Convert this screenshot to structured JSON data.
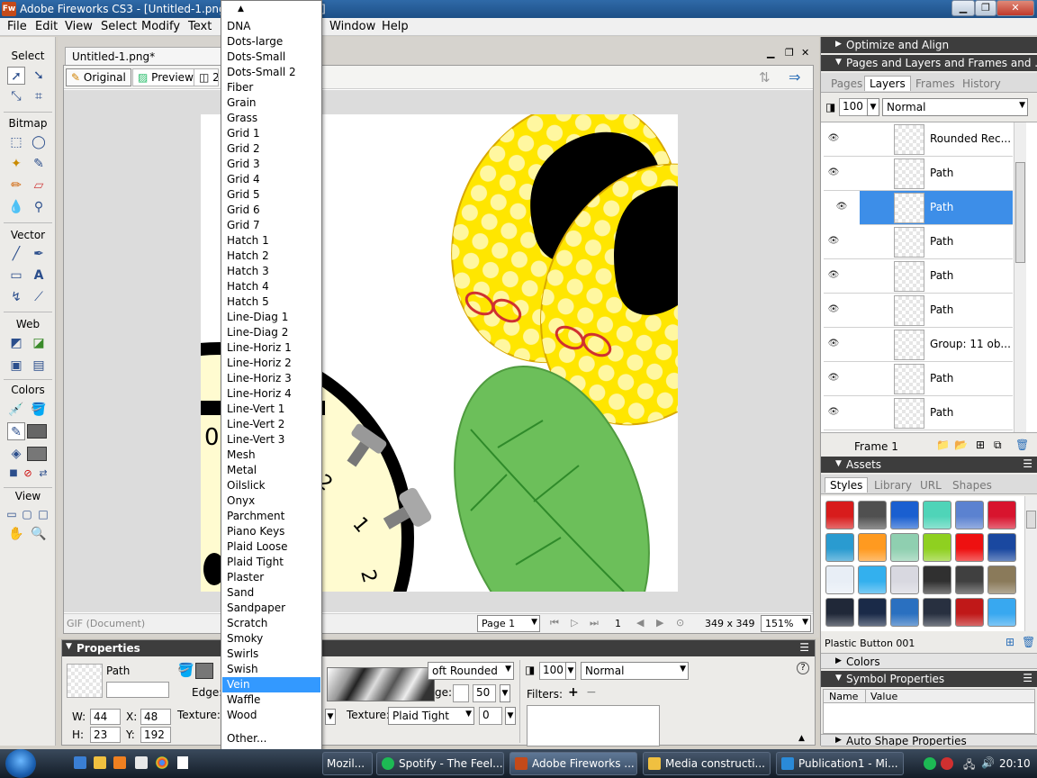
{
  "window": {
    "title": "Adobe Fireworks CS3 - [Untitled-1.png : P",
    "title_tail": "]",
    "logo": "Fw"
  },
  "menubar": [
    "File",
    "Edit",
    "View",
    "Select",
    "Modify",
    "Text",
    "Window",
    "Help"
  ],
  "tools": {
    "sections": [
      "Select",
      "Bitmap",
      "Vector",
      "Web",
      "Colors",
      "View"
    ]
  },
  "document": {
    "tab": "Untitled-1.png*",
    "view_buttons": [
      "Original",
      "Preview",
      "2-"
    ],
    "status_left": "GIF (Document)",
    "page": "Page 1",
    "frame_number": "1",
    "size": "349 x 349",
    "zoom": "151%"
  },
  "canvas_text": {
    "clock_digit_0": "0",
    "clock_digit_2a": "2",
    "clock_digit_1": "1",
    "clock_digit_2b": "2"
  },
  "dropdown": {
    "items": [
      "DNA",
      "Dots-large",
      "Dots-Small",
      "Dots-Small 2",
      "Fiber",
      "Grain",
      "Grass",
      "Grid 1",
      "Grid 2",
      "Grid 3",
      "Grid 4",
      "Grid 5",
      "Grid 6",
      "Grid 7",
      "Hatch 1",
      "Hatch 2",
      "Hatch 3",
      "Hatch 4",
      "Hatch 5",
      "Line-Diag 1",
      "Line-Diag 2",
      "Line-Horiz 1",
      "Line-Horiz 2",
      "Line-Horiz 3",
      "Line-Horiz 4",
      "Line-Vert 1",
      "Line-Vert 2",
      "Line-Vert 3",
      "Mesh",
      "Metal",
      "Oilslick",
      "Onyx",
      "Parchment",
      "Piano Keys",
      "Plaid Loose",
      "Plaid Tight",
      "Plaster",
      "Sand",
      "Sandpaper",
      "Scratch",
      "Smoky",
      "Swirls",
      "Swish",
      "Vein",
      "Waffle",
      "Wood"
    ],
    "selected": "Vein",
    "other": "Other..."
  },
  "properties": {
    "title": "Properties",
    "object_type": "Path",
    "edge_label": "Edge:",
    "texture_label": "Texture:",
    "w_label": "W:",
    "w": "44",
    "h_label": "H:",
    "h": "23",
    "x_label": "X:",
    "x": "48",
    "y_label": "Y:",
    "y": "192",
    "stroke_tip": "oft Rounded",
    "edge_partial": "ge:",
    "edge_value": "50",
    "stroke_texture_label": "Texture:",
    "stroke_texture": "Plaid Tight",
    "stroke_texture_amount": "0",
    "opacity": "100",
    "blend": "Normal",
    "filters_label": "Filters:",
    "filters_add": "+",
    "filters_remove": "−"
  },
  "panels": {
    "optimize": "Optimize and Align",
    "pages_layers": "Pages and Layers and Frames and ...",
    "tabs": [
      "Pages",
      "Layers",
      "Frames",
      "History"
    ],
    "active_tab": "Layers",
    "opacity": "100",
    "blend": "Normal",
    "layers": [
      "Rounded Rec...",
      "Path",
      "Path",
      "Path",
      "Path",
      "Path",
      "Group: 11 ob...",
      "Path",
      "Path"
    ],
    "selected_layer_index": 2,
    "frame_label": "Frame 1",
    "assets": "Assets",
    "assets_tabs": [
      "Styles",
      "Library",
      "URL",
      "Shapes"
    ],
    "assets_active": "Styles",
    "style_name": "Plastic Button 001",
    "colors": "Colors",
    "symbol_properties": "Symbol Properties",
    "sym_cols": [
      "Name",
      "Value"
    ],
    "auto_shape": "Auto Shape Properties"
  },
  "swatch_colors": [
    "#d81c1c",
    "#505050",
    "#1a5fd0",
    "#4fd4b8",
    "#5b82d0",
    "#d8142e",
    "#2a9bd0",
    "#ff9a20",
    "#8fcfb0",
    "#8fd020",
    "#ee1010",
    "#1a48a0",
    "#e8eef6",
    "#33b0ee",
    "#d8d8e0",
    "#303030",
    "#404040",
    "#8a7a5a",
    "#202838",
    "#1a2a48",
    "#2a70c0",
    "#283040",
    "#c01818",
    "#38a8f0"
  ],
  "taskbar": {
    "buttons": [
      " Mozil...",
      "Spotify - The Feel...",
      "Adobe Fireworks ...",
      "Media constructi...",
      "Publication1 - Mi..."
    ],
    "active": "Adobe Fireworks ...",
    "clock": "20:10"
  }
}
